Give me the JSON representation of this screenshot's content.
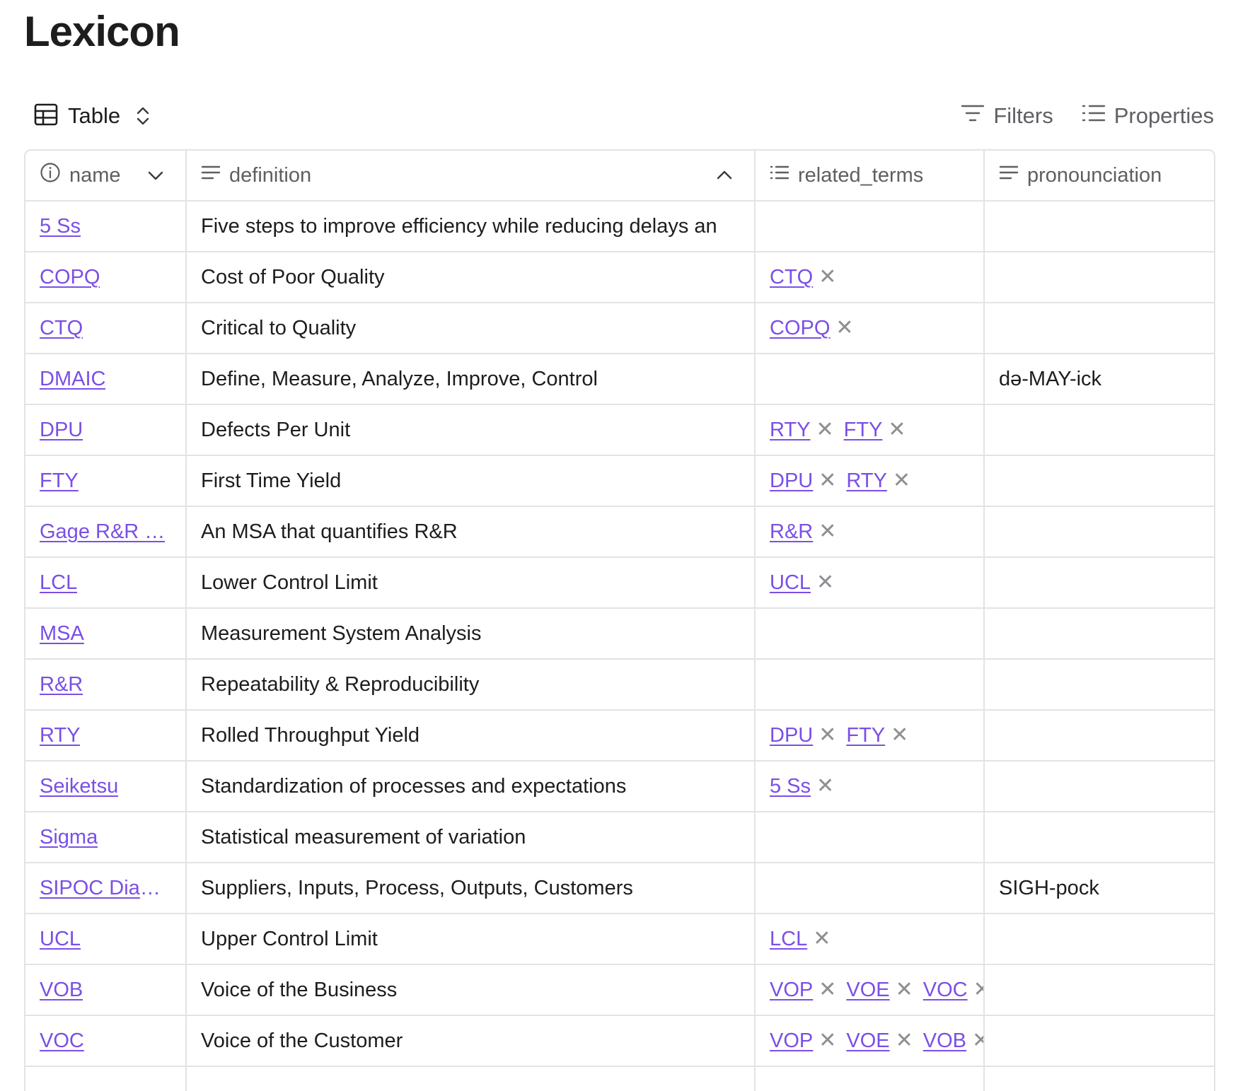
{
  "page": {
    "title": "Lexicon"
  },
  "toolbar": {
    "view_label": "Table",
    "filters_label": "Filters",
    "properties_label": "Properties"
  },
  "columns": {
    "name": "name",
    "definition": "definition",
    "related_terms": "related_terms",
    "pronounciation": "pronounciation"
  },
  "rows": [
    {
      "name": "5 Ss",
      "definition": "Five steps to improve efficiency while reducing delays an",
      "related": [],
      "pron": ""
    },
    {
      "name": "COPQ",
      "definition": "Cost of Poor Quality",
      "related": [
        "CTQ"
      ],
      "pron": ""
    },
    {
      "name": "CTQ",
      "definition": "Critical to Quality",
      "related": [
        "COPQ"
      ],
      "pron": ""
    },
    {
      "name": "DMAIC",
      "definition": "Define, Measure, Analyze, Improve, Control",
      "related": [],
      "pron": "də-MAY-ick"
    },
    {
      "name": "DPU",
      "definition": "Defects Per Unit",
      "related": [
        "RTY",
        "FTY"
      ],
      "pron": ""
    },
    {
      "name": "FTY",
      "definition": "First Time Yield",
      "related": [
        "DPU",
        "RTY"
      ],
      "pron": ""
    },
    {
      "name": "Gage R&R …",
      "definition": "An MSA that quantifies R&R",
      "related": [
        "R&R"
      ],
      "pron": ""
    },
    {
      "name": "LCL",
      "definition": "Lower Control Limit",
      "related": [
        "UCL"
      ],
      "pron": ""
    },
    {
      "name": "MSA",
      "definition": "Measurement System Analysis",
      "related": [],
      "pron": ""
    },
    {
      "name": "R&R",
      "definition": "Repeatability & Reproducibility",
      "related": [],
      "pron": ""
    },
    {
      "name": "RTY",
      "definition": "Rolled Throughput Yield",
      "related": [
        "DPU",
        "FTY"
      ],
      "pron": ""
    },
    {
      "name": "Seiketsu",
      "definition": "Standardization of processes and expectations",
      "related": [
        "5 Ss"
      ],
      "pron": ""
    },
    {
      "name": "Sigma",
      "definition": "Statistical measurement of variation",
      "related": [],
      "pron": ""
    },
    {
      "name": "SIPOC Diag…",
      "definition": "Suppliers, Inputs, Process, Outputs, Customers",
      "related": [],
      "pron": "SIGH-pock"
    },
    {
      "name": "UCL",
      "definition": "Upper Control Limit",
      "related": [
        "LCL"
      ],
      "pron": ""
    },
    {
      "name": "VOB",
      "definition": "Voice of the Business",
      "related": [
        "VOP",
        "VOE",
        "VOC"
      ],
      "pron": ""
    },
    {
      "name": "VOC",
      "definition": "Voice of the Customer",
      "related": [
        "VOP",
        "VOE",
        "VOB"
      ],
      "pron": ""
    },
    {
      "name": "",
      "definition": "",
      "related": [],
      "pron": ""
    }
  ],
  "colors": {
    "link": "#7a4fe6",
    "border": "#e3e3e6",
    "muted": "#5f5f63"
  },
  "icons": {
    "view": "table-grid-icon",
    "view_toggle": "chevron-up-down-icon",
    "filters": "filter-lines-icon",
    "properties": "list-icon",
    "name_col": "info-circle-icon",
    "definition_col": "text-lines-icon",
    "related_col": "list-icon",
    "pron_col": "text-lines-icon",
    "remove": "close-x-icon"
  }
}
